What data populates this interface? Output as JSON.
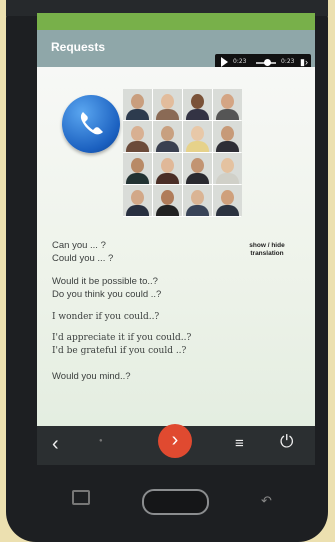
{
  "header": {
    "title": "Requests"
  },
  "player": {
    "elapsed": "0:23",
    "total": "0:23"
  },
  "icons": {
    "call": "phone-handset-icon",
    "volume": "speaker-icon",
    "play": "play-icon"
  },
  "photos_count": 16,
  "phrases": [
    "Can you ... ?",
    "Could you ... ?",
    "Would it be possible to..?",
    "Do you think you could ..?",
    "I wonder if you could..?",
    "I'd appreciate it if you could..?",
    "I'd be grateful if you could ..?",
    "Would you mind..?"
  ],
  "toggle": {
    "line1": "show / hide",
    "line2": "translation"
  },
  "nav": {
    "prev": "‹",
    "next": "›",
    "menu": "≡",
    "power": "⏻"
  },
  "colors": {
    "header": "#8fa7a9",
    "accent_next": "#e04a30",
    "navbar": "#2b2f31",
    "call_button": "#1a5fbf"
  }
}
